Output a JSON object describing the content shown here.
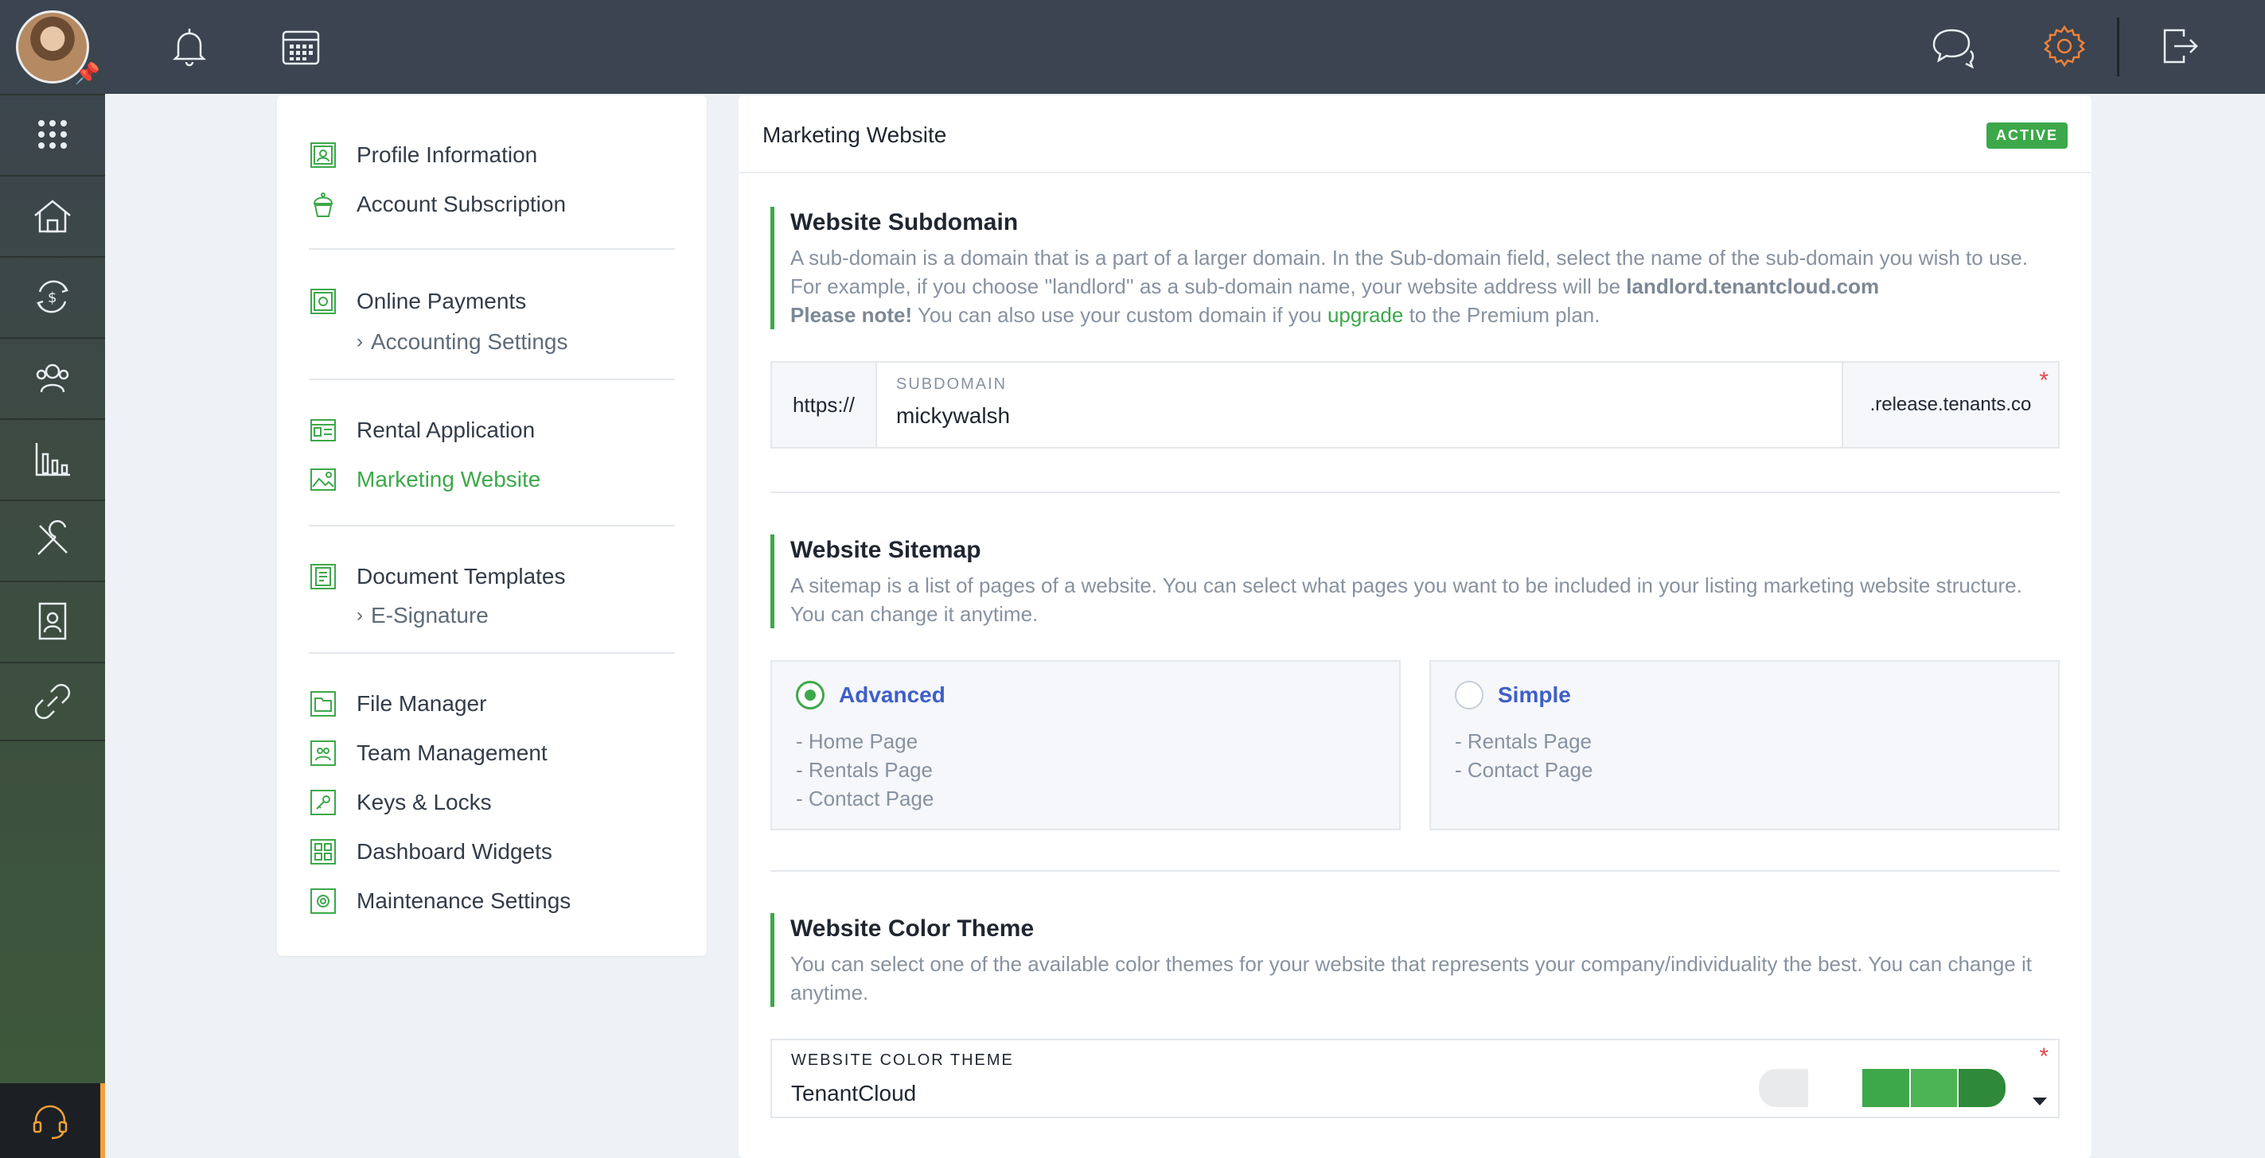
{
  "topbar": {
    "icons": [
      "bell-icon",
      "calendar-icon",
      "chat-icon",
      "gear-icon",
      "logout-icon"
    ]
  },
  "sidebar": {
    "items": [
      "apps-grid-icon",
      "properties-icon",
      "payments-icon",
      "people-icon",
      "reports-icon",
      "maintenance-icon",
      "documents-icon",
      "link-icon"
    ],
    "help_icon": "headset-icon"
  },
  "menu": {
    "profile": "Profile Information",
    "subscription": "Account Subscription",
    "online_payments": "Online Payments",
    "accounting_settings": "Accounting Settings",
    "rental_application": "Rental Application",
    "marketing_website": "Marketing Website",
    "document_templates": "Document Templates",
    "esignature": "E-Signature",
    "file_manager": "File Manager",
    "team_management": "Team Management",
    "keys_locks": "Keys & Locks",
    "dashboard_widgets": "Dashboard Widgets",
    "maintenance_settings": "Maintenance Settings"
  },
  "main": {
    "title": "Marketing Website",
    "status": "ACTIVE",
    "subdomain": {
      "title": "Website Subdomain",
      "desc1": "A sub-domain is a domain that is a part of a larger domain. In the Sub-domain field, select the name of the sub-domain you wish to use. For example, if you choose ''landlord'' as a sub-domain name, your website address will be ",
      "desc_bold": "landlord.tenantcloud.com",
      "note_bold": "Please note!",
      "note_text": " You can also use your custom domain if you ",
      "note_link": "upgrade",
      "note_end": " to the Premium plan.",
      "prefix": "https://",
      "field_label": "SUBDOMAIN",
      "field_value": "mickywalsh",
      "suffix": ".release.tenants.co",
      "required": "*"
    },
    "sitemap": {
      "title": "Website Sitemap",
      "desc": "A sitemap is a list of pages of a website. You can select what pages you want to be included in your listing marketing website structure. You can change it anytime.",
      "advanced": {
        "name": "Advanced",
        "pages": [
          "- Home Page",
          "- Rentals Page",
          "- Contact Page"
        ]
      },
      "simple": {
        "name": "Simple",
        "pages": [
          "- Rentals Page",
          "- Contact Page"
        ]
      }
    },
    "theme": {
      "title": "Website Color Theme",
      "desc": "You can select one of the available color themes for your website that represents your company/individuality the best. You can change it anytime.",
      "label": "WEBSITE COLOR THEME",
      "value": "TenantCloud",
      "required": "*",
      "swatches": [
        "#e8eaec",
        "#3da84a",
        "#4cb454",
        "#2e8a3a"
      ]
    }
  },
  "colors": {
    "accent": "#3da84a",
    "topbar": "#3b4450",
    "link_blue": "#3e5fc9",
    "help_accent": "#f0a13a"
  }
}
